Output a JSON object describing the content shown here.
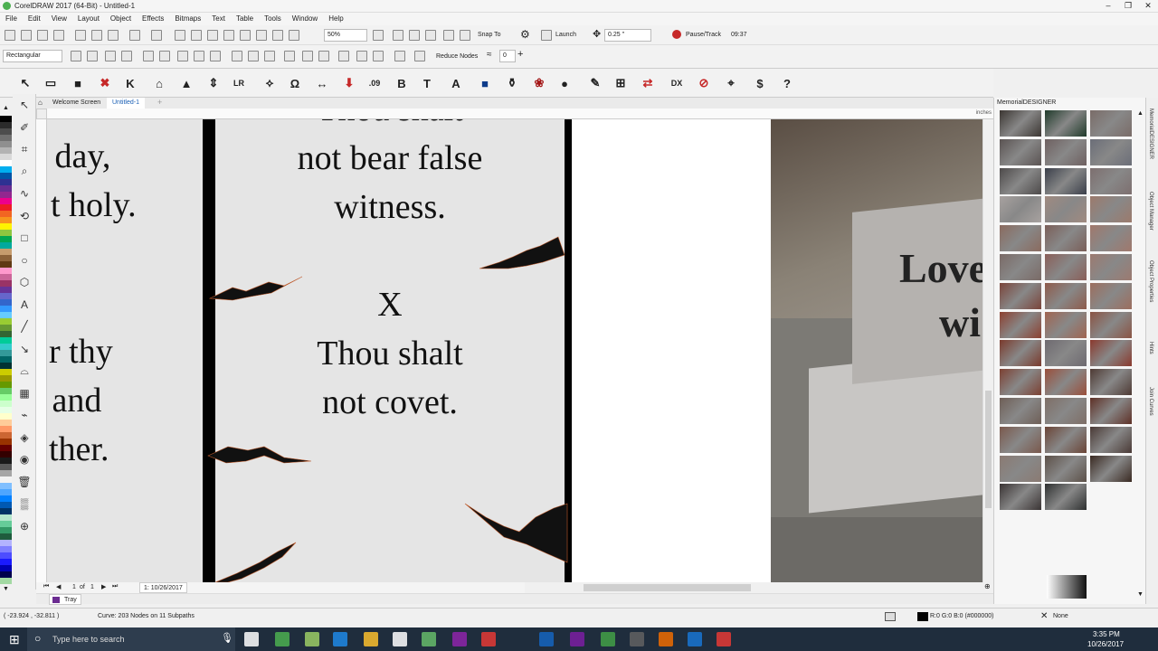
{
  "window": {
    "title": "CorelDRAW 2017 (64-Bit) - Untitled-1"
  },
  "menu": [
    "File",
    "Edit",
    "View",
    "Layout",
    "Object",
    "Effects",
    "Bitmaps",
    "Text",
    "Table",
    "Tools",
    "Window",
    "Help"
  ],
  "standard_toolbar": {
    "zoom": "50%",
    "snap": "Snap To",
    "launch": "Launch",
    "nudge": "0.25 \"",
    "pause_track": "Pause/Track",
    "time_field": "09:37"
  },
  "property_bar": {
    "shape_mode": "Rectangular",
    "reduce_nodes": "Reduce Nodes",
    "smoothing": "0"
  },
  "custom_toolbar": {
    "icons": [
      "arrow-icon",
      "rectangle-icon",
      "color-square-icon",
      "red-x-icon",
      "k-icon",
      "tray-icon",
      "stones-icon",
      "arrows-icon",
      "lr-rvl-icon",
      "cut-icon",
      "node-icon",
      "stretch-icon",
      "download-icon",
      "number-icon",
      "bold-icon",
      "font-icon",
      "text-a-icon",
      "blue-square-icon",
      "vase-icon",
      "rose-icon",
      "oval-icon",
      "pen-icon",
      "plus-box-icon",
      "flip-icon",
      "dxf-icon",
      "no-ruler-icon",
      "zoom-target-icon",
      "dollar-icon",
      "help-icon"
    ],
    "number_label": ".09",
    "dxf_label": "DXF\nDEV"
  },
  "tabs": {
    "welcome": "Welcome Screen",
    "doc": "Untitled-1"
  },
  "ruler": {
    "units": "inches"
  },
  "canvas": {
    "left_text": [
      "n day,",
      "t holy.",
      "r thy",
      " and",
      "ther."
    ],
    "center_partial": "Thou shalt",
    "center_top": [
      "not bear false",
      "witness."
    ],
    "commandment_number": "X",
    "center_bottom": [
      "Thou shalt",
      "not covet."
    ],
    "photo_text": [
      "Love",
      "wi"
    ]
  },
  "docker": {
    "title": "MemorialDESIGNER",
    "granite_colors": [
      "#3c3632",
      "#1f3a2a",
      "#7a6c68",
      "#5a5352",
      "#6e6060",
      "#6b6e78",
      "#4d4a4a",
      "#3a3f4a",
      "#7d6f6f",
      "#a8a2a0",
      "#a08a80",
      "#9c7a6c",
      "#8a6a5e",
      "#7a5e58",
      "#a0786c",
      "#7a6a66",
      "#8a5e58",
      "#9c7a70",
      "#7a443a",
      "#8e5a4a",
      "#9c6e5e",
      "#8c4030",
      "#a06450",
      "#8a5444",
      "#7a3a2c",
      "#6e6a70",
      "#8a3a2e",
      "#7c4032",
      "#9a4e3a",
      "#4e3a34",
      "#6e5e56",
      "#7e6e66",
      "#5e3026",
      "#7a584c",
      "#6a4436",
      "#4a3a36",
      "#8a7a72",
      "#5c5048",
      "#3a2a22",
      "#3a3434",
      "#2e3030"
    ]
  },
  "right_tabs": [
    "MemorialDESIGNER",
    "Object Manager",
    "Object Properties",
    "Hints",
    "Join Curves"
  ],
  "doc_nav": {
    "page": "1",
    "of": "of",
    "total": "1",
    "page_tab": "1: 10/26/2017"
  },
  "tray": {
    "label": "Tray"
  },
  "status": {
    "coords": "( -23.924 , -32.811 )",
    "selection": "Curve: 203 Nodes on 11 Subpaths",
    "fill": "R:0 G:0 B:0 (#000000)",
    "outline": "None"
  },
  "taskbar": {
    "search_placeholder": "Type here to search",
    "time": "3:35 PM",
    "date": "10/26/2017"
  },
  "palette": [
    "#000000",
    "#2b2b2b",
    "#4d4d4d",
    "#707070",
    "#8f8f8f",
    "#b3b3b3",
    "#d9d9d9",
    "#ffffff",
    "#00aeef",
    "#0054a6",
    "#2e3192",
    "#662d91",
    "#92278f",
    "#ec008c",
    "#ed1c24",
    "#f26522",
    "#f7941d",
    "#fff200",
    "#8dc63f",
    "#00a651",
    "#00a99d",
    "#c69c6d",
    "#8c6239",
    "#603913",
    "#ff99cc",
    "#cc6699",
    "#993366",
    "#663399",
    "#6666cc",
    "#3366cc",
    "#3399ff",
    "#66ccff",
    "#99cc33",
    "#669933",
    "#336633",
    "#00cc99",
    "#33cccc",
    "#339999",
    "#006666",
    "#003333",
    "#cccc00",
    "#999900",
    "#669900",
    "#66cc66",
    "#99ff99",
    "#ccffcc",
    "#e6ffe6",
    "#ffffcc",
    "#ffcc99",
    "#ff9966",
    "#cc6633",
    "#993300",
    "#660000",
    "#330000",
    "#1a1a1a",
    "#595959",
    "#a6a6a6",
    "#f2f2f2",
    "#80bfff",
    "#4da6ff",
    "#0080ff",
    "#0059b3",
    "#003366",
    "#b3e6cc",
    "#66cc99",
    "#339966",
    "#1f5c3d",
    "#b3b3ff",
    "#8080ff",
    "#4d4dff",
    "#1a1aff",
    "#0000b3",
    "#00004d",
    "#a3d9a3"
  ]
}
